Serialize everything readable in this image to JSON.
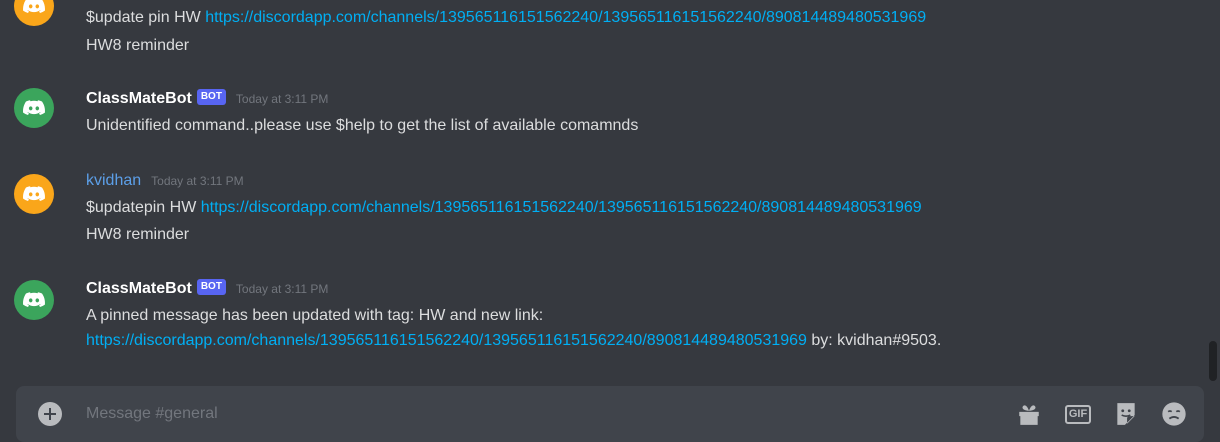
{
  "messages": [
    {
      "lines": [
        {
          "text": "$update pin HW ",
          "link": "https://discordapp.com/channels/139565116151562240/139565116151562240/890814489480531969",
          "suffix": ""
        },
        {
          "text": "HW8 reminder",
          "link": "",
          "suffix": ""
        }
      ]
    },
    {
      "username": "ClassMateBot",
      "badge": "BOT",
      "timestamp": "Today at 3:11 PM",
      "lines": [
        {
          "text": "Unidentified command..please use $help to get the list of available comamnds",
          "link": "",
          "suffix": ""
        }
      ]
    },
    {
      "username": "kvidhan",
      "timestamp": "Today at 3:11 PM",
      "lines": [
        {
          "text": "$updatepin HW ",
          "link": "https://discordapp.com/channels/139565116151562240/139565116151562240/890814489480531969",
          "suffix": ""
        },
        {
          "text": "HW8 reminder",
          "link": "",
          "suffix": ""
        }
      ]
    },
    {
      "username": "ClassMateBot",
      "badge": "BOT",
      "timestamp": "Today at 3:11 PM",
      "lines": [
        {
          "text": "A pinned message has been updated with tag: HW and new link:",
          "link": "",
          "suffix": ""
        },
        {
          "text": "",
          "link": "https://discordapp.com/channels/139565116151562240/139565116151562240/890814489480531969",
          "suffix": " by: kvidhan#9503."
        }
      ]
    }
  ],
  "composer": {
    "placeholder": "Message #general",
    "gif_label": "GIF"
  },
  "icons": {
    "avatar": "discord-logo-icon",
    "attach": "plus-circle-icon",
    "gift": "gift-icon",
    "gif": "gif-icon",
    "sticker": "sticker-icon",
    "emoji": "emoji-icon"
  },
  "colors": {
    "background": "#36393f",
    "link": "#00aff4",
    "bot_badge": "#5865f2",
    "avatar_orange": "#faa61a",
    "avatar_green": "#3ba55c",
    "username_blue": "#5c9fe8"
  }
}
